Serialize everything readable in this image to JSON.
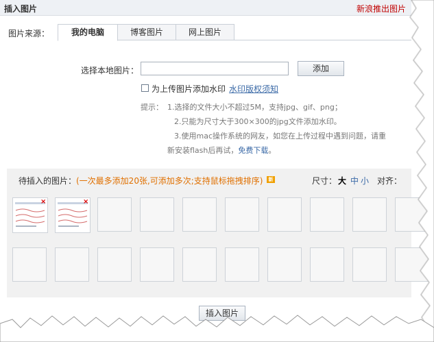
{
  "header": {
    "title": "插入图片",
    "promo": "新浪推出图片"
  },
  "source": {
    "label": "图片来源：",
    "tabs": [
      {
        "label": "我的电脑",
        "active": true
      },
      {
        "label": "博客图片",
        "active": false
      },
      {
        "label": "网上图片",
        "active": false
      }
    ]
  },
  "upload": {
    "label": "选择本地图片：",
    "file_value": "",
    "add_button": "添加",
    "watermark_checked": false,
    "watermark_label": "为上传图片添加水印",
    "watermark_link": "水印版权须知"
  },
  "tips": {
    "label": "提示：",
    "line1": "1.选择的文件大小不超过5M，支持jpg、gif、png；",
    "line2": "2.只能为尺寸大于300×300的jpg文件添加水印。",
    "line3": "3.使用mac操作系统的网友，如您在上传过程中遇到问题，请重",
    "line4_text": "新安装flash后再试，",
    "line4_link": "免费下载",
    "line4_end": "。"
  },
  "pending": {
    "label": "待插入的图片：",
    "hint": "(一次最多添加20张,可添加多次;支持鼠标拖拽排序)",
    "badge": "新",
    "size_label": "尺寸：",
    "size_options": [
      "大",
      "中",
      "小"
    ],
    "align_label": "对齐：",
    "thumbnails": 2,
    "delete_icon": "close-icon"
  },
  "footer": {
    "insert_button": "插入图片"
  }
}
